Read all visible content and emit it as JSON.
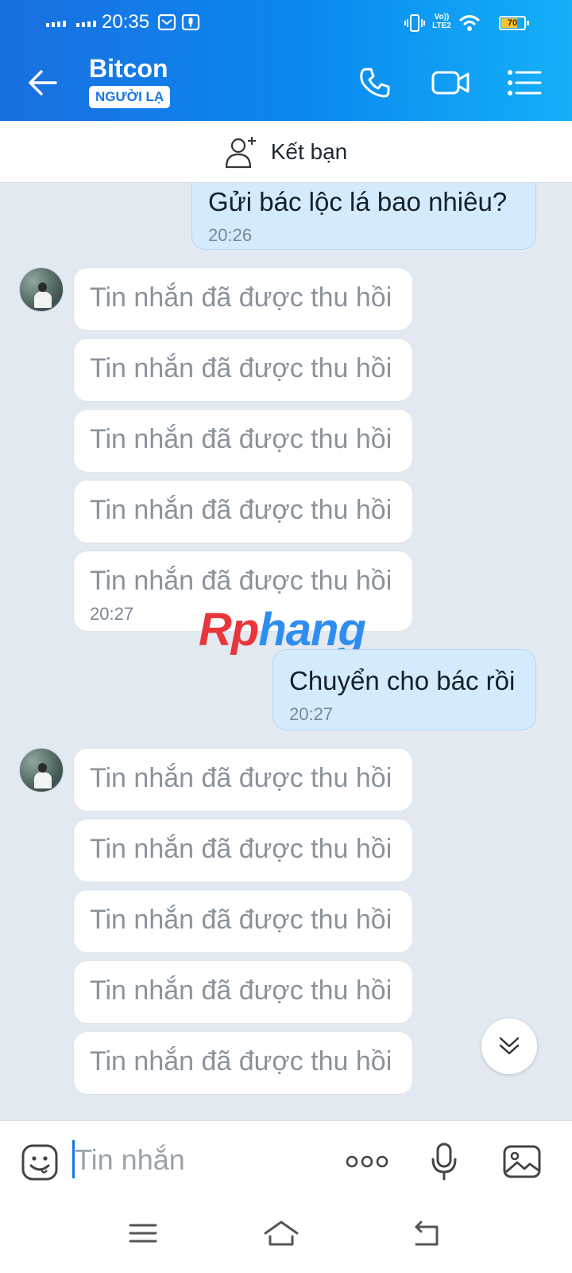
{
  "status_bar": {
    "time": "20:35",
    "battery": "70",
    "network": "LTE2"
  },
  "header": {
    "title": "Bitcon",
    "badge": "NGƯỜI LẠ"
  },
  "friend_bar": {
    "label": "Kết bạn"
  },
  "messages": {
    "m1": {
      "text": "Gửi bác lộc lá  bao nhiêu?",
      "time": "20:26"
    },
    "recalled_text": "Tin nhắn đã được thu hồi",
    "group1_time": "20:27",
    "m2": {
      "text": "Chuyển cho bác rồi",
      "time": "20:27"
    }
  },
  "watermark": {
    "part1": "Rp",
    "part2": "hang"
  },
  "composer": {
    "placeholder": "Tin nhắn"
  },
  "colors": {
    "header_start": "#1a6fe0",
    "header_end": "#15b0f8",
    "my_bubble": "#d4ebfd",
    "accent": "#1677e6"
  }
}
